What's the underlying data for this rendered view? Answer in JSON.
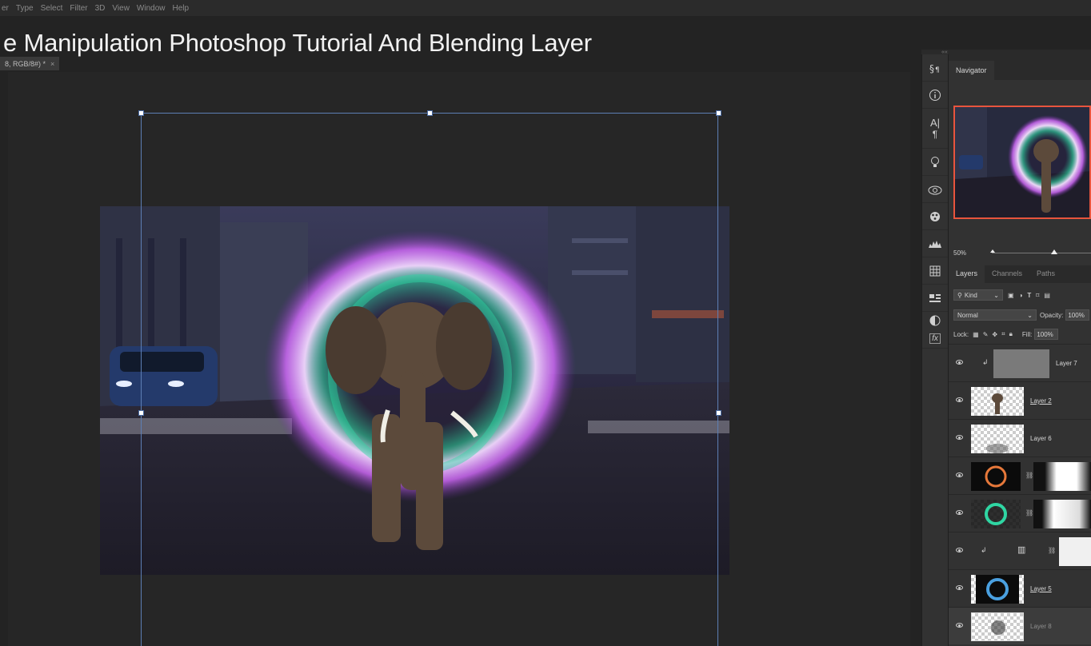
{
  "menu": [
    "er",
    "Type",
    "Select",
    "Filter",
    "3D",
    "View",
    "Window",
    "Help"
  ],
  "video_title": "e Manipulation Photoshop Tutorial And Blending Layer",
  "doc_tab": {
    "label": "8, RGB/8#) *",
    "close": "×"
  },
  "dock_collapse": "««",
  "iconbar": [
    "paragraph-styles-icon",
    "info-icon",
    "character-icon",
    "paragraph-icon",
    "lightbulb-icon",
    "creative-cloud-icon",
    "color-icon",
    "histogram-icon",
    "swatches-grid-icon",
    "properties-icon",
    "adjust-icon",
    "fx-icon"
  ],
  "navigator": {
    "tab": "Navigator",
    "zoom": "50%"
  },
  "layers_panel": {
    "tabs": [
      "Layers",
      "Channels",
      "Paths"
    ],
    "filter_kind": "Kind",
    "blend_mode": "Normal",
    "opacity_label": "Opacity:",
    "opacity_value": "100%",
    "lock_label": "Lock:",
    "fill_label": "Fill:",
    "fill_value": "100%",
    "layers": [
      {
        "name": "Layer 7"
      },
      {
        "name": "Layer 2"
      },
      {
        "name": "Layer 6"
      },
      {
        "name": ""
      },
      {
        "name": ""
      },
      {
        "name": ""
      },
      {
        "name": "Layer 5"
      },
      {
        "name": "Layer 8"
      }
    ]
  },
  "colors": {
    "accent": "#e8543d",
    "selection": "#5d7fb5",
    "glow": "#d66bff",
    "teal": "#2fd6a3"
  }
}
